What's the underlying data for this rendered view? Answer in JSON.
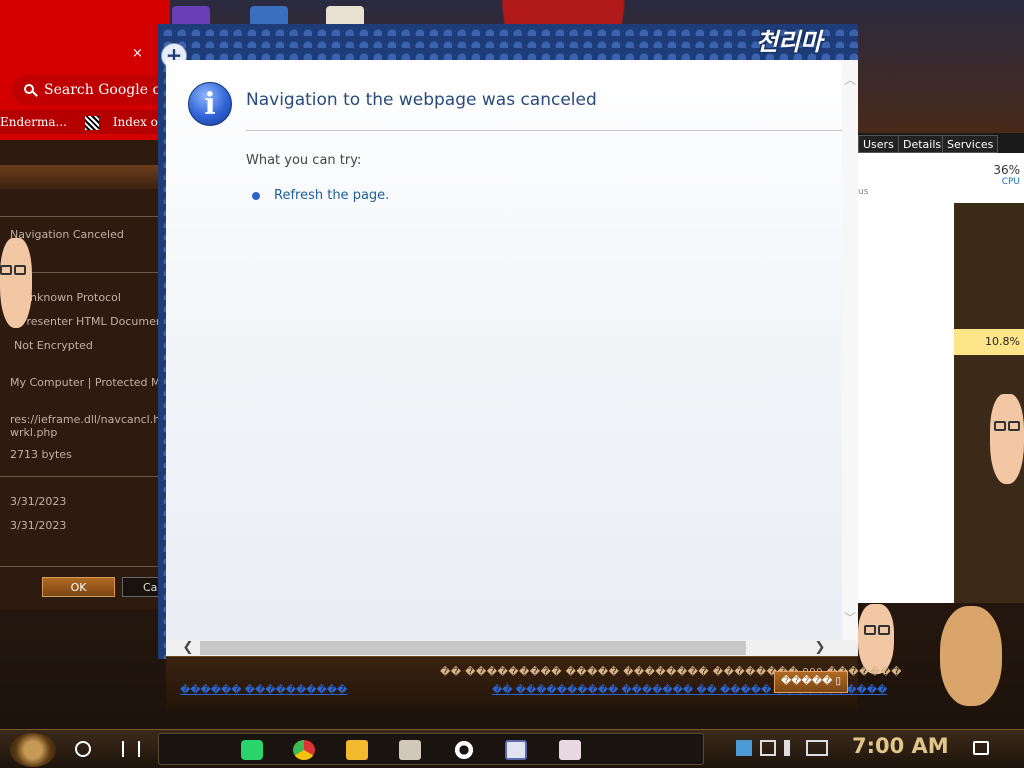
{
  "background": {
    "chrome": {
      "search_placeholder": "Search Google or",
      "bookmarks": [
        "Enderma...",
        "Index of ~da"
      ],
      "close_glyph": "×"
    },
    "properties_dialog": {
      "rows": [
        "Navigation Canceled",
        "Unknown Protocol",
        "Presenter HTML Document",
        "Not Encrypted",
        "My Computer | Protected Mode: O",
        "res://ieframe.dll/navcancl.htm#h",
        "wrkl.php",
        "2713 bytes",
        "3/31/2023",
        "3/31/2023"
      ],
      "ok_label": "OK",
      "cancel_label": "Canc"
    },
    "task_manager": {
      "tabs": [
        "Users",
        "Details",
        "Services"
      ],
      "cpu_percent": "36%",
      "cpu_label": "CPU",
      "status_label": "us",
      "highlight_value": "10.8%"
    }
  },
  "ie": {
    "new_tab_glyph": "+",
    "brand_text": "천리마",
    "content": {
      "info_glyph": "i",
      "title": "Navigation to the webpage was canceled",
      "try_label": "What you can try:",
      "refresh_link": "Refresh the page."
    },
    "scroll": {
      "up": "︿",
      "down": "﹀",
      "left": "❮",
      "right": "❯"
    },
    "notification": {
      "line1": "�� ��������� ����� �������� �������� 999 �������",
      "line2": "������ ����������",
      "line3": "�� ���������� ������� �� ����� �����������",
      "button_label": "����� ▯"
    }
  },
  "taskbar": {
    "clock": "7:00 AM"
  }
}
